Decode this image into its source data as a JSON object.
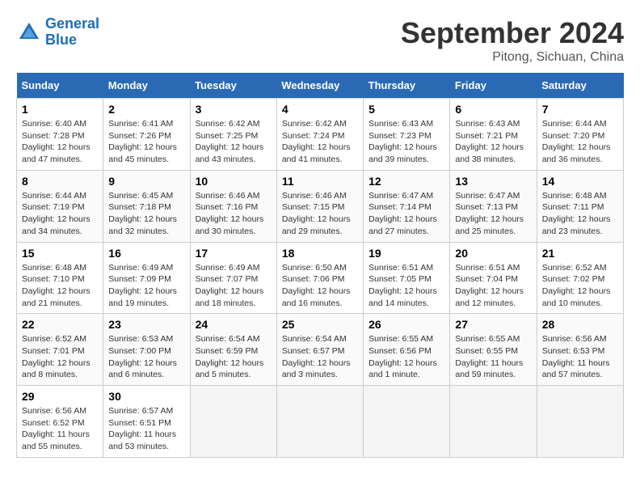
{
  "header": {
    "logo_line1": "General",
    "logo_line2": "Blue",
    "month": "September 2024",
    "location": "Pitong, Sichuan, China"
  },
  "days_of_week": [
    "Sunday",
    "Monday",
    "Tuesday",
    "Wednesday",
    "Thursday",
    "Friday",
    "Saturday"
  ],
  "weeks": [
    [
      {
        "day": "1",
        "sunrise": "6:40 AM",
        "sunset": "7:28 PM",
        "daylight": "12 hours and 47 minutes."
      },
      {
        "day": "2",
        "sunrise": "6:41 AM",
        "sunset": "7:26 PM",
        "daylight": "12 hours and 45 minutes."
      },
      {
        "day": "3",
        "sunrise": "6:42 AM",
        "sunset": "7:25 PM",
        "daylight": "12 hours and 43 minutes."
      },
      {
        "day": "4",
        "sunrise": "6:42 AM",
        "sunset": "7:24 PM",
        "daylight": "12 hours and 41 minutes."
      },
      {
        "day": "5",
        "sunrise": "6:43 AM",
        "sunset": "7:23 PM",
        "daylight": "12 hours and 39 minutes."
      },
      {
        "day": "6",
        "sunrise": "6:43 AM",
        "sunset": "7:21 PM",
        "daylight": "12 hours and 38 minutes."
      },
      {
        "day": "7",
        "sunrise": "6:44 AM",
        "sunset": "7:20 PM",
        "daylight": "12 hours and 36 minutes."
      }
    ],
    [
      {
        "day": "8",
        "sunrise": "6:44 AM",
        "sunset": "7:19 PM",
        "daylight": "12 hours and 34 minutes."
      },
      {
        "day": "9",
        "sunrise": "6:45 AM",
        "sunset": "7:18 PM",
        "daylight": "12 hours and 32 minutes."
      },
      {
        "day": "10",
        "sunrise": "6:46 AM",
        "sunset": "7:16 PM",
        "daylight": "12 hours and 30 minutes."
      },
      {
        "day": "11",
        "sunrise": "6:46 AM",
        "sunset": "7:15 PM",
        "daylight": "12 hours and 29 minutes."
      },
      {
        "day": "12",
        "sunrise": "6:47 AM",
        "sunset": "7:14 PM",
        "daylight": "12 hours and 27 minutes."
      },
      {
        "day": "13",
        "sunrise": "6:47 AM",
        "sunset": "7:13 PM",
        "daylight": "12 hours and 25 minutes."
      },
      {
        "day": "14",
        "sunrise": "6:48 AM",
        "sunset": "7:11 PM",
        "daylight": "12 hours and 23 minutes."
      }
    ],
    [
      {
        "day": "15",
        "sunrise": "6:48 AM",
        "sunset": "7:10 PM",
        "daylight": "12 hours and 21 minutes."
      },
      {
        "day": "16",
        "sunrise": "6:49 AM",
        "sunset": "7:09 PM",
        "daylight": "12 hours and 19 minutes."
      },
      {
        "day": "17",
        "sunrise": "6:49 AM",
        "sunset": "7:07 PM",
        "daylight": "12 hours and 18 minutes."
      },
      {
        "day": "18",
        "sunrise": "6:50 AM",
        "sunset": "7:06 PM",
        "daylight": "12 hours and 16 minutes."
      },
      {
        "day": "19",
        "sunrise": "6:51 AM",
        "sunset": "7:05 PM",
        "daylight": "12 hours and 14 minutes."
      },
      {
        "day": "20",
        "sunrise": "6:51 AM",
        "sunset": "7:04 PM",
        "daylight": "12 hours and 12 minutes."
      },
      {
        "day": "21",
        "sunrise": "6:52 AM",
        "sunset": "7:02 PM",
        "daylight": "12 hours and 10 minutes."
      }
    ],
    [
      {
        "day": "22",
        "sunrise": "6:52 AM",
        "sunset": "7:01 PM",
        "daylight": "12 hours and 8 minutes."
      },
      {
        "day": "23",
        "sunrise": "6:53 AM",
        "sunset": "7:00 PM",
        "daylight": "12 hours and 6 minutes."
      },
      {
        "day": "24",
        "sunrise": "6:54 AM",
        "sunset": "6:59 PM",
        "daylight": "12 hours and 5 minutes."
      },
      {
        "day": "25",
        "sunrise": "6:54 AM",
        "sunset": "6:57 PM",
        "daylight": "12 hours and 3 minutes."
      },
      {
        "day": "26",
        "sunrise": "6:55 AM",
        "sunset": "6:56 PM",
        "daylight": "12 hours and 1 minute."
      },
      {
        "day": "27",
        "sunrise": "6:55 AM",
        "sunset": "6:55 PM",
        "daylight": "11 hours and 59 minutes."
      },
      {
        "day": "28",
        "sunrise": "6:56 AM",
        "sunset": "6:53 PM",
        "daylight": "11 hours and 57 minutes."
      }
    ],
    [
      {
        "day": "29",
        "sunrise": "6:56 AM",
        "sunset": "6:52 PM",
        "daylight": "11 hours and 55 minutes."
      },
      {
        "day": "30",
        "sunrise": "6:57 AM",
        "sunset": "6:51 PM",
        "daylight": "11 hours and 53 minutes."
      },
      {
        "day": "",
        "sunrise": "",
        "sunset": "",
        "daylight": ""
      },
      {
        "day": "",
        "sunrise": "",
        "sunset": "",
        "daylight": ""
      },
      {
        "day": "",
        "sunrise": "",
        "sunset": "",
        "daylight": ""
      },
      {
        "day": "",
        "sunrise": "",
        "sunset": "",
        "daylight": ""
      },
      {
        "day": "",
        "sunrise": "",
        "sunset": "",
        "daylight": ""
      }
    ]
  ]
}
